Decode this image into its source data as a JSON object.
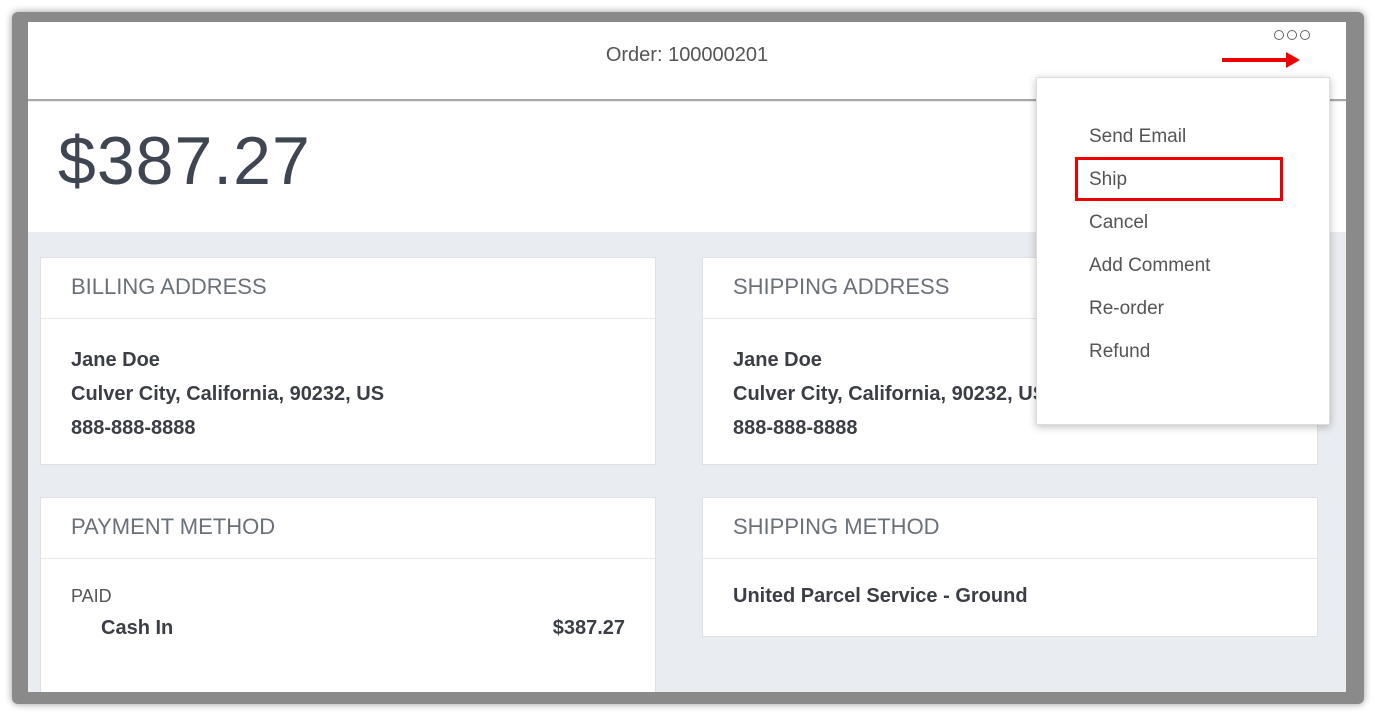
{
  "header": {
    "title": "Order: 100000201"
  },
  "total": "$387.27",
  "billing": {
    "title": "BILLING ADDRESS",
    "name": "Jane Doe",
    "address": "Culver City, California, 90232, US",
    "phone": "888-888-8888"
  },
  "shipping": {
    "title": "SHIPPING ADDRESS",
    "name": "Jane Doe",
    "address": "Culver City, California, 90232, US",
    "phone": "888-888-8888"
  },
  "payment": {
    "title": "PAYMENT METHOD",
    "status": "PAID",
    "method": "Cash In",
    "amount": "$387.27"
  },
  "shipping_method": {
    "title": "SHIPPING METHOD",
    "value": "United Parcel Service - Ground"
  },
  "menu": {
    "items": [
      "Send Email",
      "Ship",
      "Cancel",
      "Add Comment",
      "Re-order",
      "Refund"
    ]
  },
  "colors": {
    "highlight": "#e00000"
  }
}
